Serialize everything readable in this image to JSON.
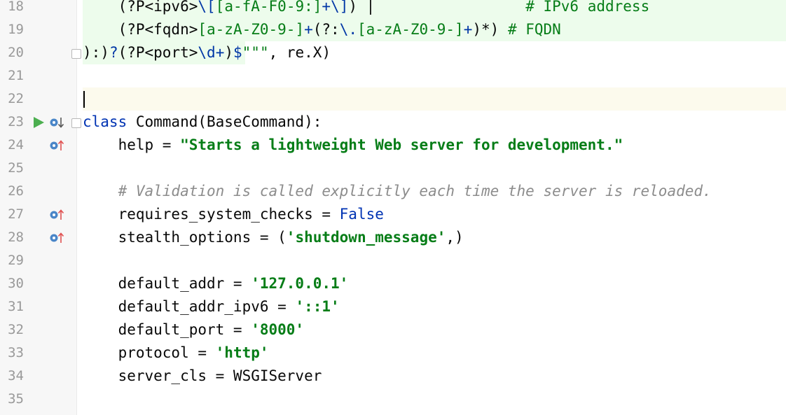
{
  "gutter": {
    "line_numbers": [
      "18",
      "19",
      "20",
      "21",
      "22",
      "23",
      "24",
      "25",
      "26",
      "27",
      "28",
      "29",
      "30",
      "31",
      "32",
      "33",
      "34",
      "35"
    ]
  },
  "code": {
    "l18": {
      "indent": "    ",
      "open": "(?P<ipv6>",
      "esc1": "\\[",
      "cls": "[a-fA-F0-9:]",
      "plus": "+",
      "esc2": "\\]",
      "close": ") |",
      "comment": "# IPv6 address"
    },
    "l19": {
      "indent": "    ",
      "open": "(?P<fqdn>",
      "cls1": "[a-zA-Z0-9-]",
      "plus1": "+",
      "grp": "(?:",
      "esc": "\\.",
      "cls2": "[a-zA-Z0-9-]",
      "plus2": "+",
      "close": ")*",
      "close2": ")",
      "comment": "# FQDN"
    },
    "l20": {
      "start": "):)",
      "q": "?",
      "open": "(?P<port>",
      "d": "\\d",
      "plus": "+",
      "close": ")",
      "end": "$",
      "triple": "\"\"\"",
      "rest": ", re.X)"
    },
    "l23": {
      "kw": "class",
      "rest": " Command(BaseCommand):"
    },
    "l24": {
      "name": "    help = ",
      "value": "\"Starts a lightweight Web server for development.\""
    },
    "l26": {
      "comment": "    # Validation is called explicitly each time the server is reloaded."
    },
    "l27": {
      "name": "    requires_system_checks = ",
      "value": "False"
    },
    "l28": {
      "name": "    stealth_options = (",
      "value": "'shutdown_message'",
      "tail": ",)"
    },
    "l30": {
      "name": "    default_addr = ",
      "value": "'127.0.0.1'"
    },
    "l31": {
      "name": "    default_addr_ipv6 = ",
      "value": "'::1'"
    },
    "l32": {
      "name": "    default_port = ",
      "value": "'8000'"
    },
    "l33": {
      "name": "    protocol = ",
      "value": "'http'"
    },
    "l34": {
      "name": "    server_cls = WSGIServer"
    }
  },
  "colors": {
    "keyword": "#0033b3",
    "string": "#067d17",
    "comment": "#8c8c8c",
    "gutter_bg": "#f7f7f7",
    "diff_added_bg": "#edfcec",
    "caret_row_bg": "#fcfaed",
    "run_icon": "#4caf50",
    "override_icon": "#4a86c8",
    "override_arrow": "#e05050"
  },
  "icons": [
    "run-icon",
    "overridden-down-icon",
    "overrides-up-icon",
    "fold-icon"
  ]
}
